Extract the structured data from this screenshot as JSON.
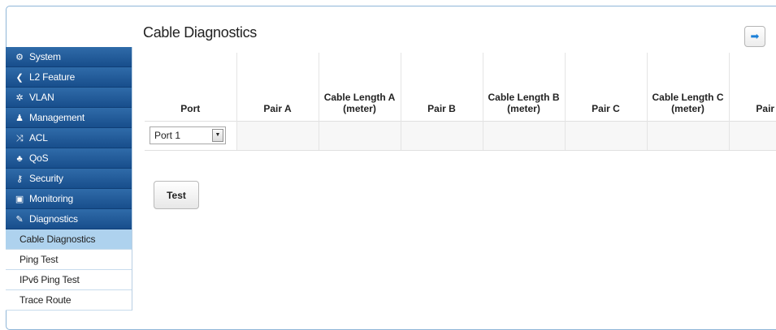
{
  "sidebar": {
    "items": [
      {
        "label": "System",
        "icon": "gear-icon",
        "glyph": "⚙"
      },
      {
        "label": "L2 Feature",
        "icon": "share-icon",
        "glyph": "❮"
      },
      {
        "label": "VLAN",
        "icon": "network-icon",
        "glyph": "✲"
      },
      {
        "label": "Management",
        "icon": "user-icon",
        "glyph": "♟"
      },
      {
        "label": "ACL",
        "icon": "shuffle-icon",
        "glyph": "⤨"
      },
      {
        "label": "QoS",
        "icon": "sitemap-icon",
        "glyph": "♣"
      },
      {
        "label": "Security",
        "icon": "key-icon",
        "glyph": "⚷"
      },
      {
        "label": "Monitoring",
        "icon": "monitor-icon",
        "glyph": "▣"
      },
      {
        "label": "Diagnostics",
        "icon": "wrench-icon",
        "glyph": "✎"
      }
    ],
    "subitems": [
      {
        "label": "Cable Diagnostics",
        "active": true
      },
      {
        "label": "Ping Test"
      },
      {
        "label": "IPv6 Ping Test"
      },
      {
        "label": "Trace Route"
      }
    ]
  },
  "page": {
    "title": "Cable Diagnostics",
    "nav_icon": "arrow-right-icon"
  },
  "table": {
    "headers": [
      "Port",
      "Pair A",
      "Cable Length A (meter)",
      "Pair B",
      "Cable Length B (meter)",
      "Pair C",
      "Cable Length C (meter)",
      "Pair D"
    ],
    "port_select": {
      "value": "Port 1"
    }
  },
  "actions": {
    "test_label": "Test"
  }
}
